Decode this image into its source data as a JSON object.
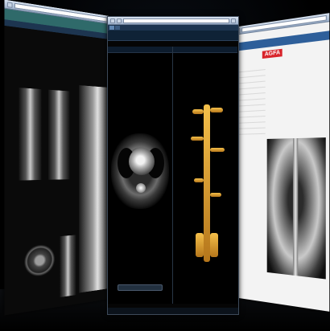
{
  "left_window": {
    "title": "",
    "tabs": [],
    "labels": []
  },
  "center_window": {
    "address": "",
    "tabs": [],
    "left_pane": {
      "header": ""
    },
    "right_pane": {
      "header": ""
    }
  },
  "right_window": {
    "brand": "AGFA",
    "address": "",
    "info_rows": []
  },
  "colors": {
    "background": "#000000",
    "chrome": "#9fb3cd",
    "dark_panel": "#0d1c2d",
    "teal_bar": "#2f6a6a",
    "agfa_red": "#d8232a",
    "vessel_gold": "#f5c04a"
  }
}
